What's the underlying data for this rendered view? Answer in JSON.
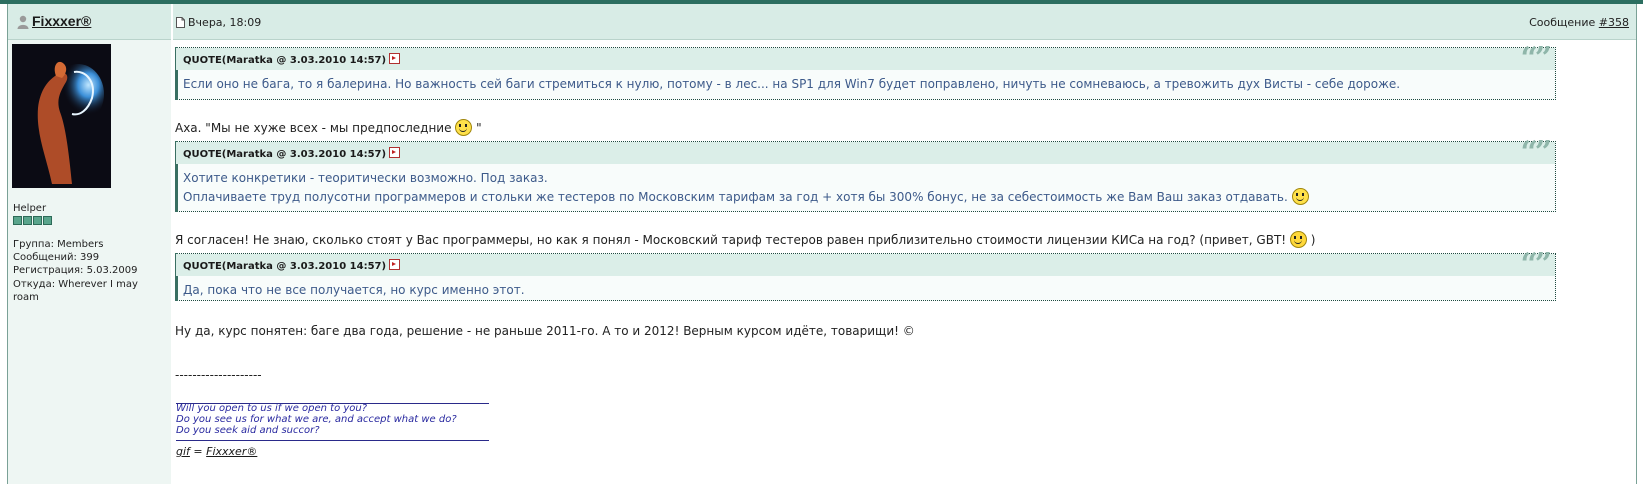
{
  "header": {
    "username": "Fixxxer®",
    "post_date": "Вчера, 18:09",
    "message_label": "Сообщение",
    "message_link": "#358"
  },
  "sidebar": {
    "rank": "Helper",
    "group": "Группа: Members",
    "posts": "Сообщений: 399",
    "registered": "Регистрация: 5.03.2009",
    "location_line1": "Откуда: Wherever I may",
    "location_line2": "roam",
    "rank_pips": 4
  },
  "post": {
    "quotes": [
      {
        "title": "QUOTE(Maratka @ 3.03.2010 14:57)",
        "lines": [
          "Если оно не бага, то я балерина. Но важность сей баги стремиться к нулю, потому - в лес... на SP1 для Win7 будет поправлено, ничуть не сомневаюсь, а тревожить дух Висты - себе дороже."
        ]
      },
      {
        "title": "QUOTE(Maratka @ 3.03.2010 14:57)",
        "lines": [
          "Хотите конкретики - теоритически возможно. Под заказ.",
          "Оплачиваете труд полусотни программеров и стольки же тестеров по Московским тарифам за год + хотя бы 300% бонус, не за себестоимость же Вам Ваш заказ отдавать."
        ]
      },
      {
        "title": "QUOTE(Maratka @ 3.03.2010 14:57)",
        "lines": [
          "Да, пока что не все получается, но курс именно этот."
        ]
      }
    ],
    "reply1": "Аха. \"Мы не хуже всех - мы предпоследние",
    "reply1_end": "\"",
    "reply2": "Я согласен! Не знаю, сколько стоят у Вас программеры, но как я понял - Московский тариф тестеров равен приблизительно стоимости лицензии КИСа на год? (привет, GBT!",
    "reply2_end": ")",
    "reply3": "Ну да, курс понятен: баге два года, решение - не раньше 2011-го. А то и 2012! Верным курсом идёте, товарищи! ©",
    "separator": "--------------------"
  },
  "signature": {
    "lines": [
      "Will you open to us if we open to you?",
      "Do you see us for what we are, and accept what we do?",
      "Do you seek aid and succor?"
    ],
    "gif_label": "gif",
    "gif_eq": " = ",
    "gif_link": "Fixxxer®"
  },
  "colors": {
    "topbar": "#2c6e60",
    "header_bg": "#d8ece6",
    "quote_text": "#3d5a8a",
    "signature_text": "#2a2aa0"
  }
}
